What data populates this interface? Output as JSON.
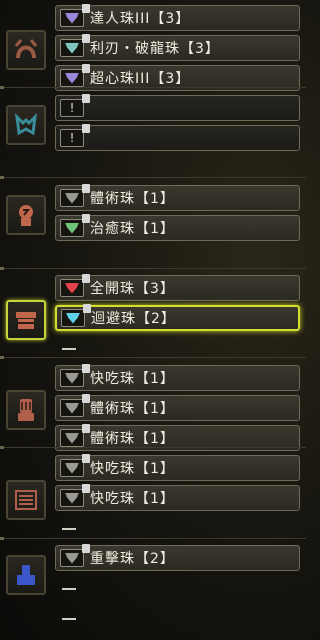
{
  "colors": {
    "selection": "#d3de30",
    "gem_purple": "#9a88d8",
    "gem_teal": "#7ec8c0",
    "gem_gray": "#9a9a90",
    "gem_green": "#6dc47a",
    "gem_red": "#e0444c",
    "gem_cyan": "#5fd0e8"
  },
  "equipment": [
    {
      "name": "head",
      "icon": "helmet-icon",
      "icon_color": "#9a5a44",
      "slots": [
        {
          "label": "達人珠III【3】",
          "gem": "gem_purple"
        },
        {
          "label": "利刃・破龍珠【3】",
          "gem": "gem_teal"
        },
        {
          "label": "超心珠III【3】",
          "gem": "gem_purple"
        }
      ],
      "trailing_dash": false
    },
    {
      "name": "chest",
      "icon": "chest-armor-icon",
      "icon_color": "#3a8c9a",
      "slots": [
        {
          "label": "",
          "gem": "none"
        },
        {
          "label": "",
          "gem": "none"
        }
      ],
      "trailing_dash": false
    },
    {
      "name": "arms",
      "icon": "arm-armor-icon",
      "icon_color": "#c0664a",
      "slots": [
        {
          "label": "體術珠【1】",
          "gem": "gem_gray"
        },
        {
          "label": "治癒珠【1】",
          "gem": "gem_green"
        }
      ],
      "trailing_dash": false
    },
    {
      "name": "waist",
      "icon": "waist-armor-icon",
      "icon_color": "#c0664a",
      "slots": [
        {
          "label": "全開珠【3】",
          "gem": "gem_red"
        },
        {
          "label": "迴避珠【2】",
          "gem": "gem_cyan",
          "selected": true
        }
      ],
      "trailing_dash": true
    },
    {
      "name": "legs",
      "icon": "leg-armor-icon",
      "icon_color": "#b0604a",
      "slots": [
        {
          "label": "快吃珠【1】",
          "gem": "gem_gray"
        },
        {
          "label": "體術珠【1】",
          "gem": "gem_gray"
        },
        {
          "label": "體術珠【1】",
          "gem": "gem_gray"
        }
      ],
      "trailing_dash": false
    },
    {
      "name": "charm",
      "icon": "charm-icon",
      "icon_color": "#b0604a",
      "slots": [
        {
          "label": "快吃珠【1】",
          "gem": "gem_gray"
        },
        {
          "label": "快吃珠【1】",
          "gem": "gem_gray"
        }
      ],
      "trailing_dash": true
    },
    {
      "name": "weapon",
      "icon": "weapon-icon",
      "icon_color": "#3a56c8",
      "slots": [
        {
          "label": "重擊珠【2】",
          "gem": "gem_gray"
        }
      ],
      "trailing_dash": true,
      "extra_dashes": 1
    }
  ]
}
